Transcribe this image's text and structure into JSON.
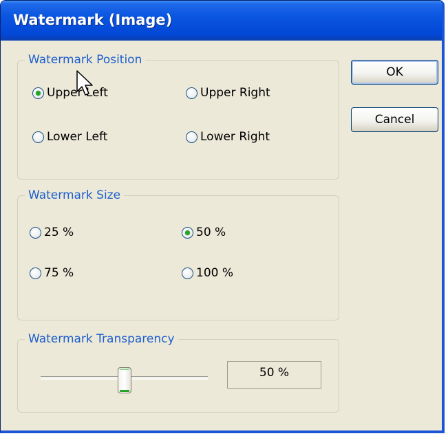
{
  "window": {
    "title": "Watermark (Image)"
  },
  "buttons": {
    "ok": "OK",
    "cancel": "Cancel"
  },
  "position_group": {
    "legend": "Watermark Position",
    "options": [
      {
        "label": "Upper Left",
        "selected": true
      },
      {
        "label": "Upper Right",
        "selected": false
      },
      {
        "label": "Lower Left",
        "selected": false
      },
      {
        "label": "Lower Right",
        "selected": false
      }
    ]
  },
  "size_group": {
    "legend": "Watermark Size",
    "options": [
      {
        "label": "25 %",
        "selected": false
      },
      {
        "label": "50 %",
        "selected": true
      },
      {
        "label": "75 %",
        "selected": false
      },
      {
        "label": "100 %",
        "selected": false
      }
    ]
  },
  "transparency_group": {
    "legend": "Watermark Transparency",
    "value_text": "50 %",
    "slider_fraction": 0.5
  },
  "colors": {
    "title_bar": "#0a55e0",
    "dialog_bg": "#ece9d8",
    "legend_text": "#1e5fcc",
    "radio_dot": "#28a428"
  },
  "icons": {
    "cursor": "mouse-pointer-icon"
  }
}
